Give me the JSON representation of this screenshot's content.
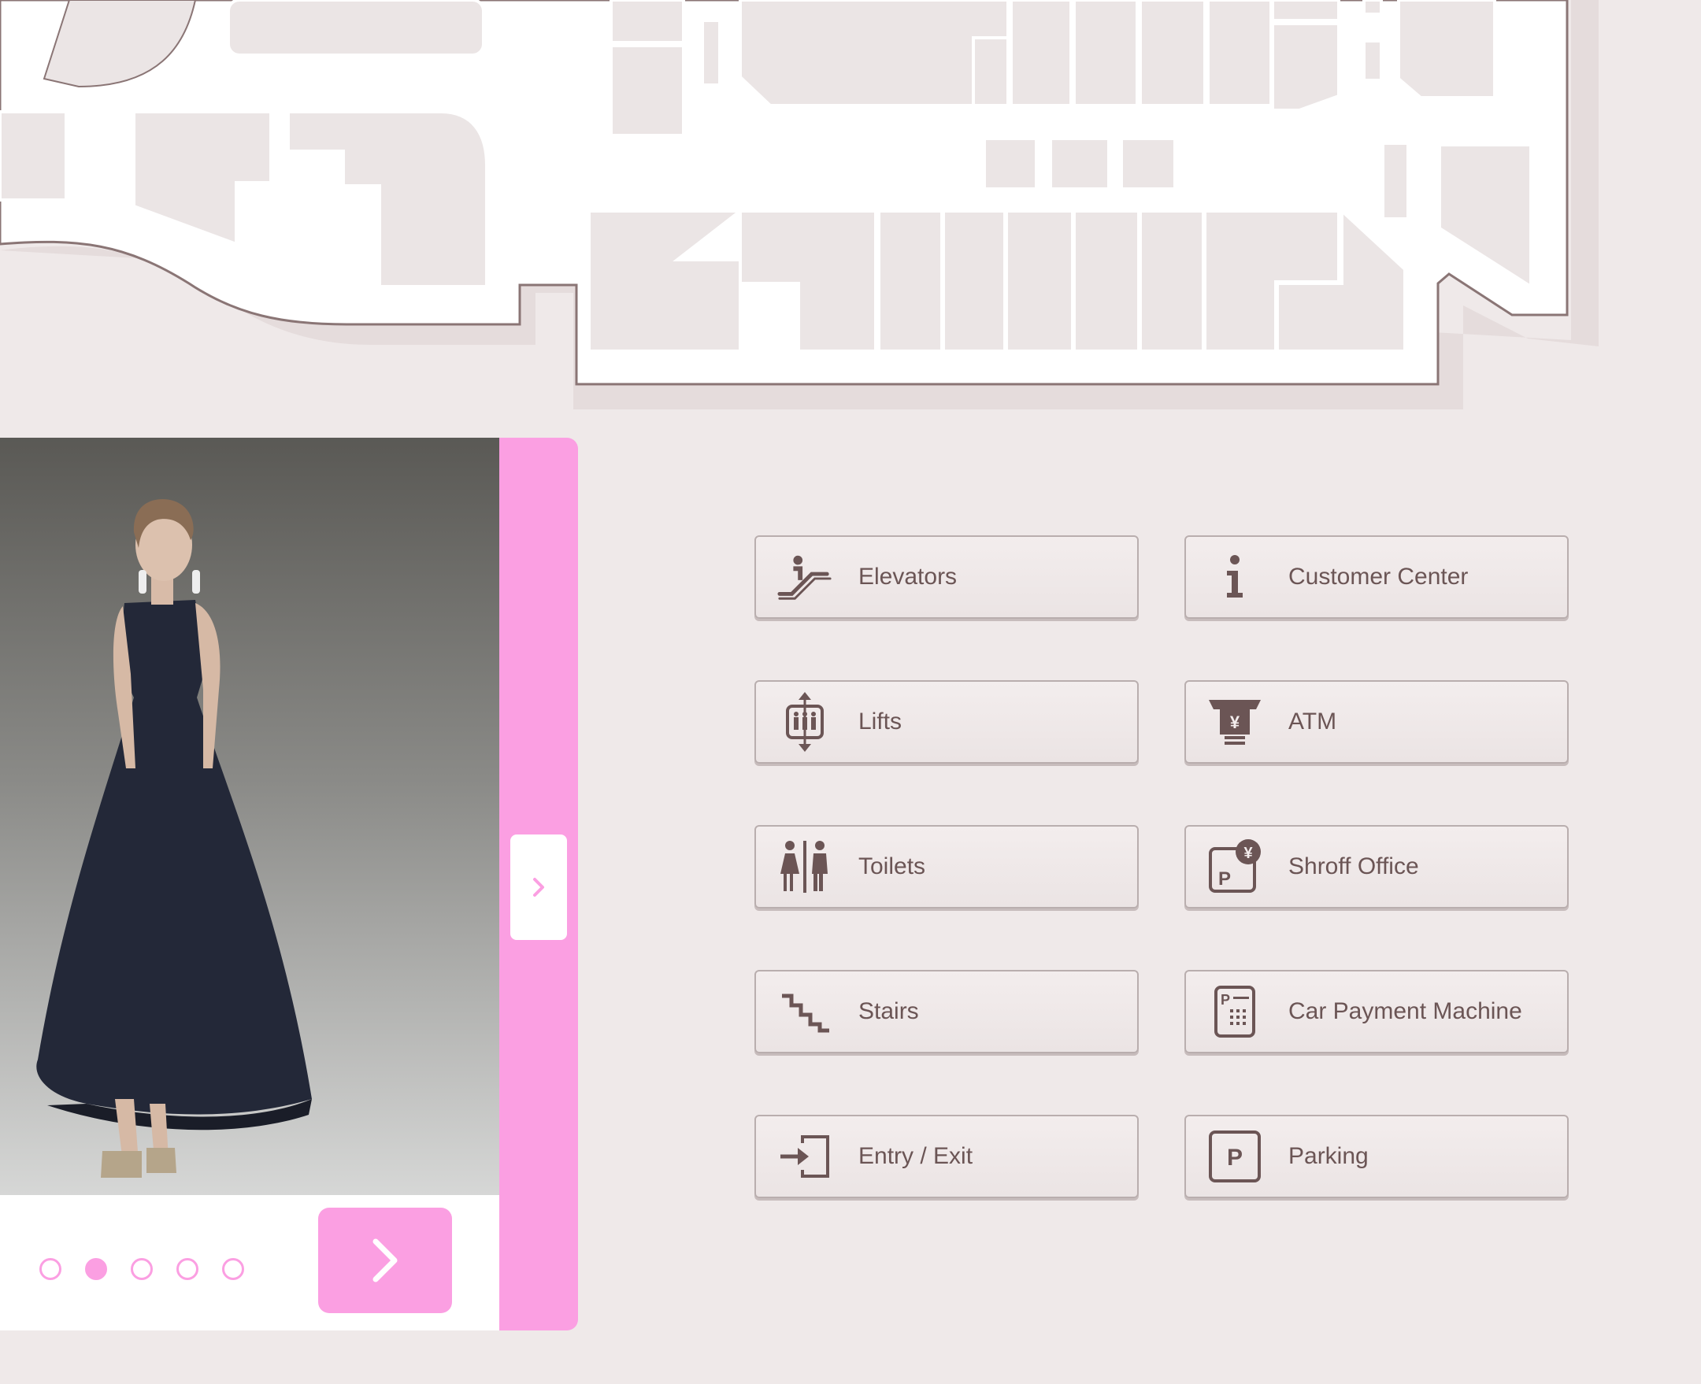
{
  "colors": {
    "background": "#efe9e9",
    "map_block": "#ebe5e5",
    "map_outline": "#8a7575",
    "accent_pink": "#fb9fe2",
    "text": "#6b5555"
  },
  "carousel": {
    "slide_count": 5,
    "active_index": 1,
    "dots": [
      {
        "icon": "dot-empty"
      },
      {
        "icon": "dot-filled"
      },
      {
        "icon": "dot-empty"
      },
      {
        "icon": "dot-empty"
      },
      {
        "icon": "dot-empty"
      }
    ],
    "next_icon": "chevron-right-icon",
    "side_icon": "chevron-right-icon"
  },
  "facilities": [
    {
      "label": "Elevators",
      "icon": "escalator-icon"
    },
    {
      "label": "Customer Center",
      "icon": "info-icon"
    },
    {
      "label": "Lifts",
      "icon": "lift-icon"
    },
    {
      "label": "ATM",
      "icon": "atm-icon"
    },
    {
      "label": "Toilets",
      "icon": "toilet-icon"
    },
    {
      "label": "Shroff Office",
      "icon": "shroff-icon"
    },
    {
      "label": "Stairs",
      "icon": "stairs-icon"
    },
    {
      "label": "Car Payment Machine",
      "icon": "car-payment-icon"
    },
    {
      "label": "Entry / Exit",
      "icon": "entry-exit-icon"
    },
    {
      "label": "Parking",
      "icon": "parking-icon"
    }
  ]
}
